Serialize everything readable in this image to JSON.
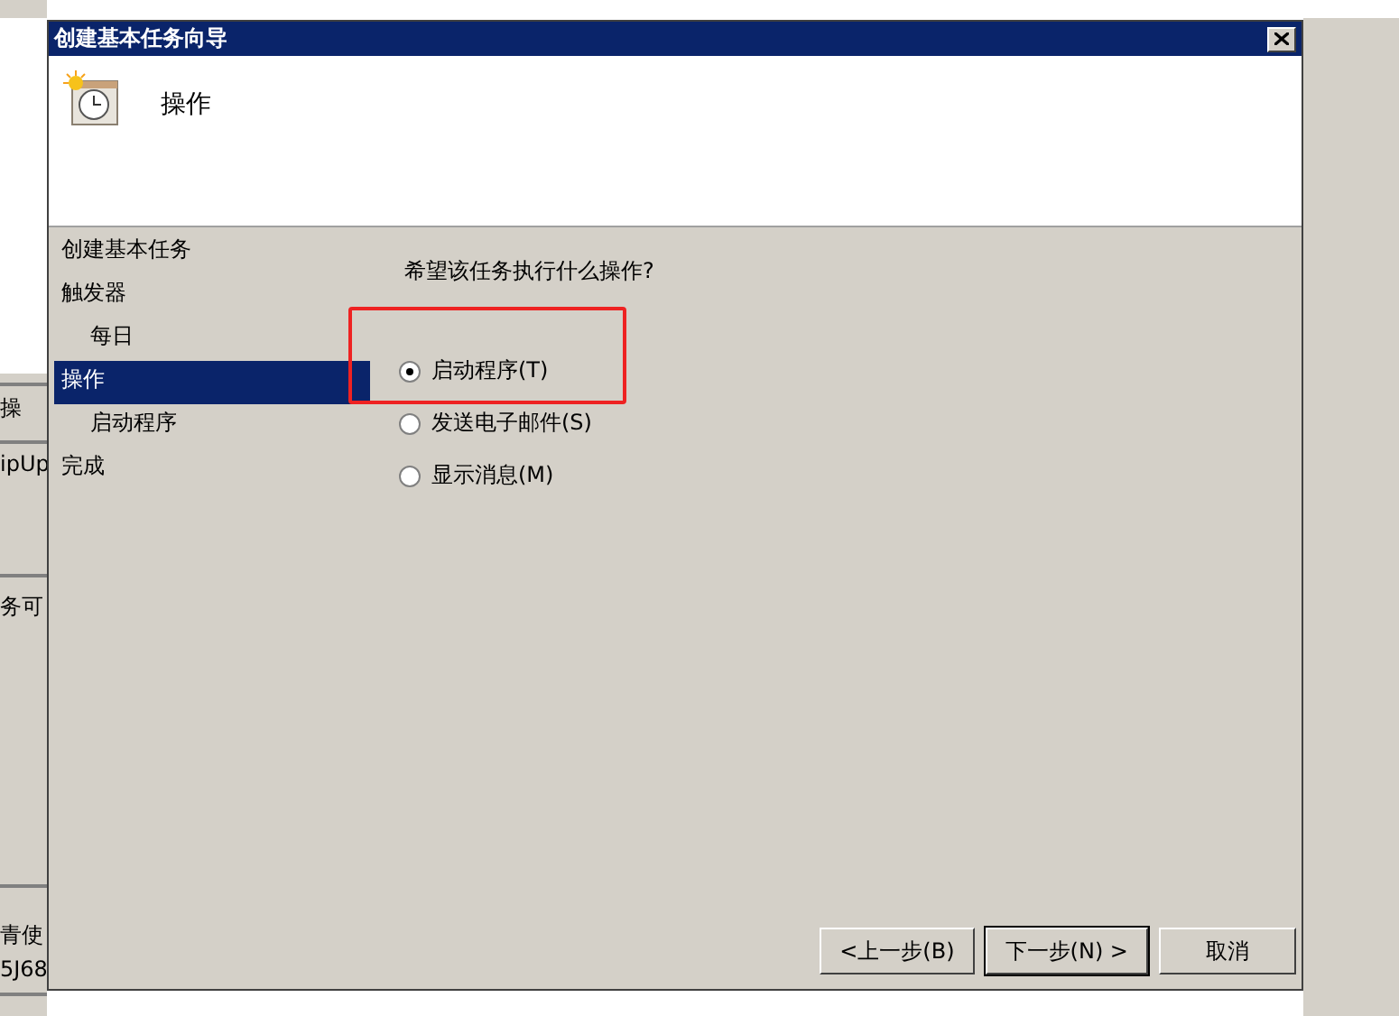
{
  "background_window": {
    "left_fragments": [
      "操",
      "ipUp",
      "务可",
      "青使",
      "5J68"
    ]
  },
  "dialog": {
    "title": "创建基本任务向导",
    "header": "操作",
    "nav": [
      {
        "label": "创建基本任务",
        "selected": false
      },
      {
        "label": "触发器",
        "selected": false,
        "children": [
          {
            "label": "每日",
            "selected": false
          }
        ]
      },
      {
        "label": "操作",
        "selected": true,
        "children": [
          {
            "label": "启动程序",
            "selected": false
          }
        ]
      },
      {
        "label": "完成",
        "selected": false
      }
    ],
    "question": "希望该任务执行什么操作?",
    "options": [
      {
        "label": "启动程序(T)",
        "selected": true,
        "highlighted": true
      },
      {
        "label": "发送电子邮件(S)",
        "selected": false,
        "highlighted": false
      },
      {
        "label": "显示消息(M)",
        "selected": false,
        "highlighted": false
      }
    ],
    "buttons": [
      "<上一步(B)",
      "下一步(N) >",
      "取消"
    ]
  }
}
